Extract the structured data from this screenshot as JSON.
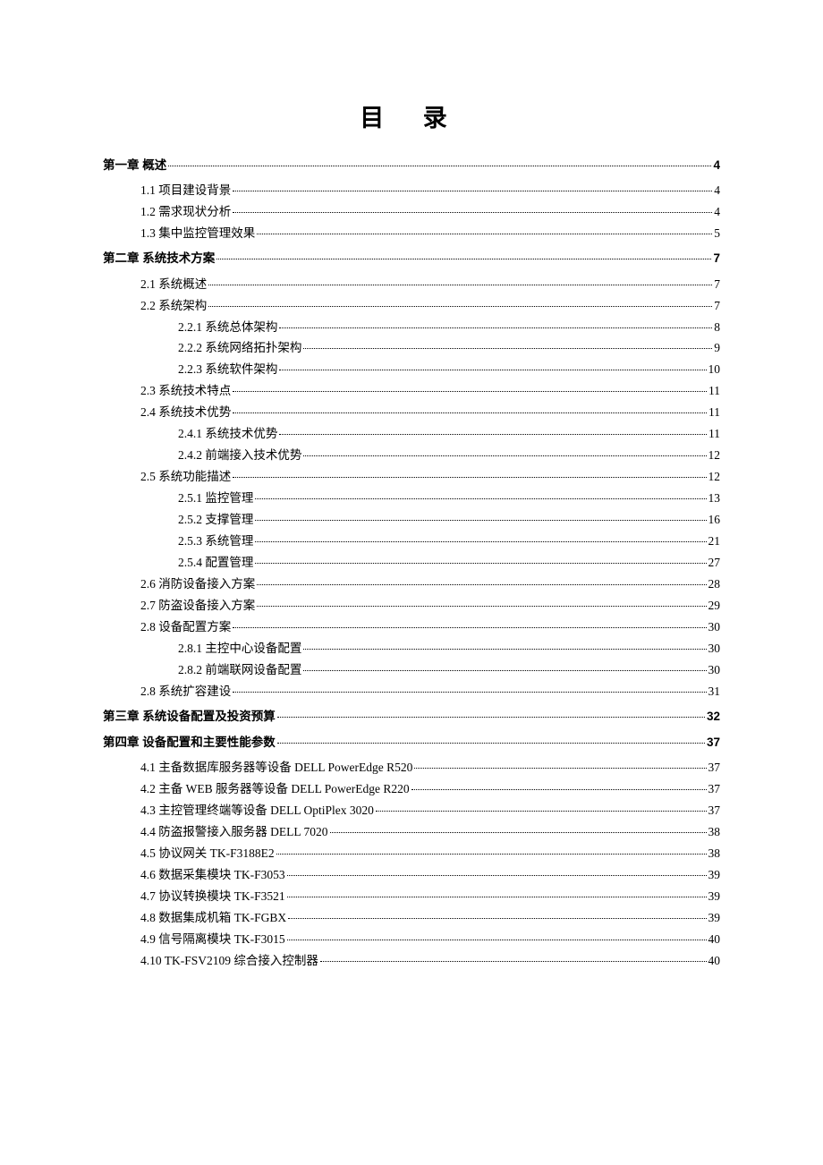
{
  "title": "目 录",
  "toc": [
    {
      "level": 0,
      "chapter": true,
      "label": "第一章 概述",
      "page": "4"
    },
    {
      "level": 1,
      "label": "1.1 项目建设背景",
      "page": "4"
    },
    {
      "level": 1,
      "label": "1.2 需求现状分析",
      "page": "4"
    },
    {
      "level": 1,
      "label": "1.3 集中监控管理效果",
      "page": "5"
    },
    {
      "level": 0,
      "chapter": true,
      "label": "第二章 系统技术方案",
      "page": "7"
    },
    {
      "level": 1,
      "label": "2.1 系统概述",
      "page": "7"
    },
    {
      "level": 1,
      "label": "2.2 系统架构",
      "page": "7"
    },
    {
      "level": 2,
      "label": "2.2.1 系统总体架构",
      "page": "8"
    },
    {
      "level": 2,
      "label": "2.2.2 系统网络拓扑架构",
      "page": "9"
    },
    {
      "level": 2,
      "label": "2.2.3 系统软件架构",
      "page": "10"
    },
    {
      "level": 1,
      "label": "2.3 系统技术特点",
      "page": "11"
    },
    {
      "level": 1,
      "label": "2.4 系统技术优势",
      "page": "11"
    },
    {
      "level": 2,
      "label": "2.4.1 系统技术优势",
      "page": "11"
    },
    {
      "level": 2,
      "label": "2.4.2 前端接入技术优势",
      "page": "12"
    },
    {
      "level": 1,
      "label": "2.5 系统功能描述",
      "page": "12"
    },
    {
      "level": 2,
      "label": "2.5.1 监控管理",
      "page": "13"
    },
    {
      "level": 2,
      "label": "2.5.2 支撑管理",
      "page": "16"
    },
    {
      "level": 2,
      "label": "2.5.3 系统管理",
      "page": "21"
    },
    {
      "level": 2,
      "label": "2.5.4 配置管理",
      "page": "27"
    },
    {
      "level": 1,
      "label": "2.6 消防设备接入方案",
      "page": "28"
    },
    {
      "level": 1,
      "label": "2.7 防盗设备接入方案",
      "page": "29"
    },
    {
      "level": 1,
      "label": "2.8 设备配置方案",
      "page": "30"
    },
    {
      "level": 2,
      "label": "2.8.1 主控中心设备配置",
      "page": "30"
    },
    {
      "level": 2,
      "label": "2.8.2 前端联网设备配置",
      "page": "30"
    },
    {
      "level": 1,
      "label": "2.8 系统扩容建设",
      "page": "31"
    },
    {
      "level": 0,
      "chapter": true,
      "label": "第三章 系统设备配置及投资预算",
      "page": "32"
    },
    {
      "level": 0,
      "chapter": true,
      "label": "第四章 设备配置和主要性能参数",
      "page": "37"
    },
    {
      "level": 1,
      "label": "4.1 主备数据库服务器等设备 DELL PowerEdge R520",
      "page": "37"
    },
    {
      "level": 1,
      "label": "4.2 主备 WEB 服务器等设备 DELL PowerEdge R220",
      "page": "37"
    },
    {
      "level": 1,
      "label": "4.3 主控管理终端等设备 DELL OptiPlex 3020",
      "page": "37"
    },
    {
      "level": 1,
      "label": "4.4 防盗报警接入服务器  DELL 7020",
      "page": "38"
    },
    {
      "level": 1,
      "label": "4.5 协议网关 TK-F3188E2",
      "page": "38"
    },
    {
      "level": 1,
      "label": "4.6 数据采集模块 TK-F3053",
      "page": "39"
    },
    {
      "level": 1,
      "label": "4.7 协议转换模块 TK-F3521",
      "page": "39"
    },
    {
      "level": 1,
      "label": "4.8 数据集成机箱 TK-FGBX",
      "page": "39"
    },
    {
      "level": 1,
      "label": "4.9 信号隔离模块 TK-F3015",
      "page": "40"
    },
    {
      "level": 1,
      "label": "4.10 TK-FSV2109 综合接入控制器",
      "page": "40"
    }
  ]
}
